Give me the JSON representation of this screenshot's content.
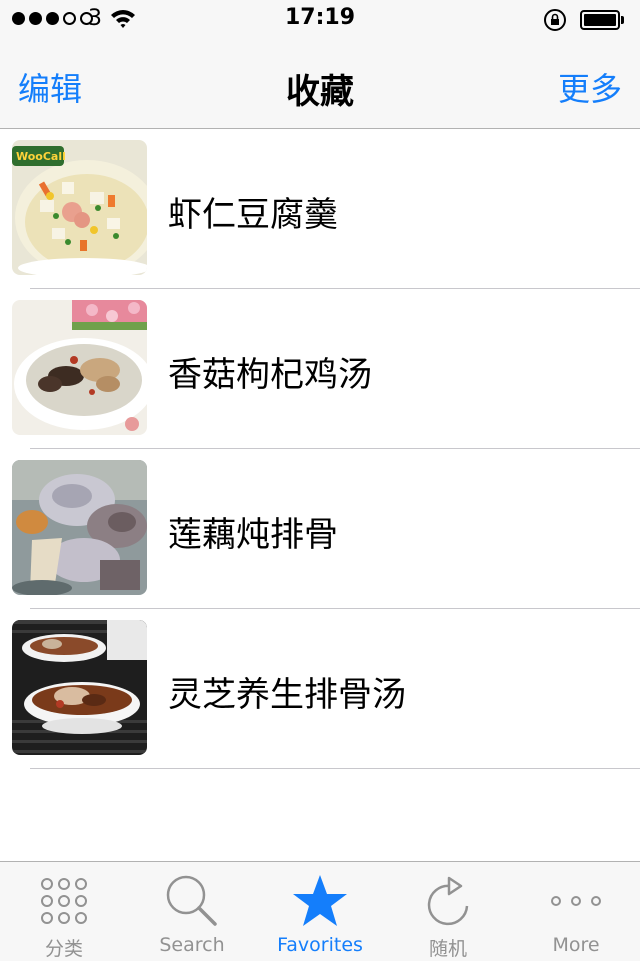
{
  "status_bar": {
    "carrier": "3",
    "time": "17:19",
    "signal_bars_filled": 3,
    "signal_bars_total": 5
  },
  "nav": {
    "left_label": "编辑",
    "title": "收藏",
    "right_label": "更多"
  },
  "favorites": [
    {
      "title": "虾仁豆腐羹",
      "thumb_icon": "shrimp-tofu-soup-photo",
      "thumb_watermark": "WooCall"
    },
    {
      "title": "香菇枸杞鸡汤",
      "thumb_icon": "mushroom-goji-chicken-soup-photo"
    },
    {
      "title": "莲藕炖排骨",
      "thumb_icon": "lotus-root-pork-ribs-photo"
    },
    {
      "title": "灵芝养生排骨汤",
      "thumb_icon": "lingzhi-pork-ribs-soup-photo"
    }
  ],
  "tabs": [
    {
      "label": "分类",
      "icon": "grid-icon",
      "active": false
    },
    {
      "label": "Search",
      "icon": "search-icon",
      "active": false
    },
    {
      "label": "Favorites",
      "icon": "star-icon",
      "active": true
    },
    {
      "label": "随机",
      "icon": "refresh-icon",
      "active": false
    },
    {
      "label": "More",
      "icon": "more-icon",
      "active": false
    }
  ],
  "colors": {
    "accent": "#147efb",
    "inactive": "#929292",
    "bar_background": "#f7f7f7"
  }
}
